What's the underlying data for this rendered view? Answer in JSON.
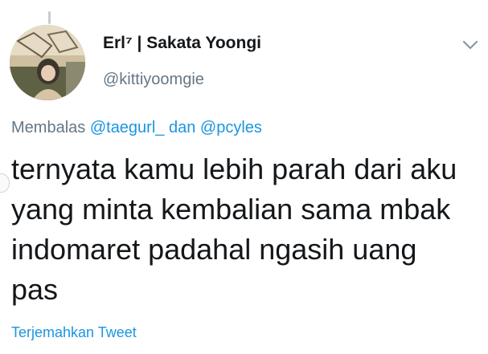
{
  "tweet": {
    "author": {
      "display_name": "Erl⁷ | Sakata Yoongi",
      "handle": "@kittiyoomgie",
      "avatar_icon": "user-photo-avatar"
    },
    "more_options_icon": "chevron-down-icon",
    "reply": {
      "prefix": "Membalas",
      "mention_1": "@taegurl_",
      "conjunction": "dan",
      "mention_2": "@pcyles"
    },
    "text": "ternyata kamu lebih parah dari aku\nyang minta kembalian sama mbak\nindomaret padahal ngasih uang\npas",
    "translate_label": "Terjemahkan Tweet",
    "colors": {
      "link": "#1b95e0",
      "secondary": "#657786",
      "primary": "#14171a"
    }
  }
}
